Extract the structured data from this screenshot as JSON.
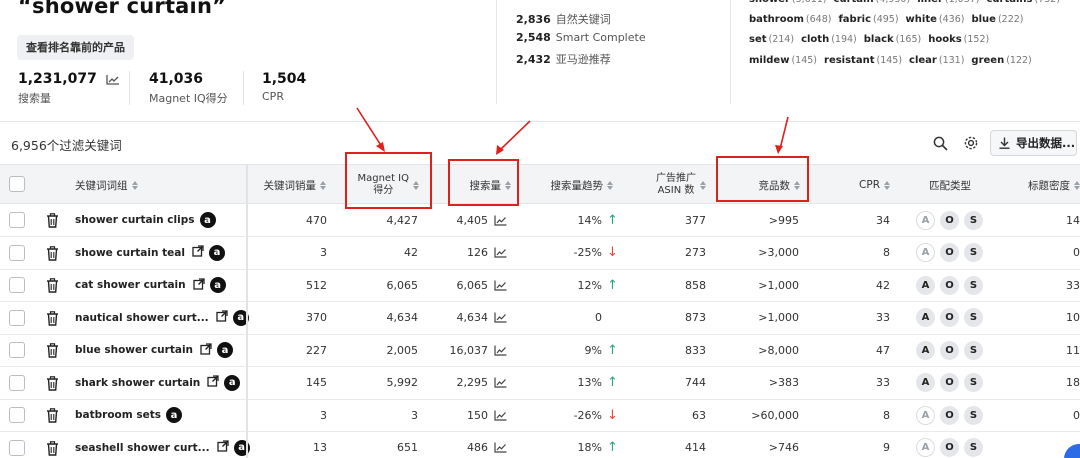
{
  "header": {
    "keyword": "“shower curtain”",
    "see_top_button": "查看排名靠前的产品",
    "stats": [
      {
        "value": "1,231,077",
        "label": "搜索量",
        "has_chart_icon": true
      },
      {
        "value": "41,036",
        "label": "Magnet IQ得分"
      },
      {
        "value": "1,504",
        "label": "CPR"
      }
    ]
  },
  "keyword_sources": [
    {
      "count": "2,836",
      "label": "自然关键词"
    },
    {
      "count": "2,548",
      "label": "Smart Complete"
    },
    {
      "count": "2,432",
      "label": "亚马逊推荐"
    }
  ],
  "word_frequency": [
    [
      {
        "w": "shower",
        "c": "(5,611)"
      },
      {
        "w": "curtain",
        "c": "(4,930)"
      },
      {
        "w": "liner",
        "c": "(1,037)"
      },
      {
        "w": "curtains",
        "c": "(732)"
      }
    ],
    [
      {
        "w": "bathroom",
        "c": "(648)"
      },
      {
        "w": "fabric",
        "c": "(495)"
      },
      {
        "w": "white",
        "c": "(436)"
      },
      {
        "w": "blue",
        "c": "(222)"
      }
    ],
    [
      {
        "w": "set",
        "c": "(214)"
      },
      {
        "w": "cloth",
        "c": "(194)"
      },
      {
        "w": "black",
        "c": "(165)"
      },
      {
        "w": "hooks",
        "c": "(152)"
      }
    ],
    [
      {
        "w": "mildew",
        "c": "(145)"
      },
      {
        "w": "resistant",
        "c": "(145)"
      },
      {
        "w": "clear",
        "c": "(131)"
      },
      {
        "w": "green",
        "c": "(122)"
      }
    ]
  ],
  "toolbar": {
    "filtered_count": "6,956个过滤关键词",
    "export_label": "导出数据..."
  },
  "table": {
    "columns": {
      "keyword_phrase": "关键词词组",
      "keyword_sales": "关键词销量",
      "magnet_iq_line1": "Magnet IQ",
      "magnet_iq_line2": "得分",
      "search_volume": "搜索量",
      "search_trend": "搜索量趋势",
      "ad_asin_line1": "广告推广",
      "ad_asin_line2": "ASIN 数",
      "competing_products": "竞品数",
      "cpr": "CPR",
      "match_type": "匹配类型",
      "title_density": "标题密度"
    },
    "rows": [
      {
        "keyword": "shower curtain clips",
        "sales": "470",
        "iq": "4,427",
        "volume": "4,405",
        "trend": "14%",
        "trend_dir": "up",
        "asins": "377",
        "competing": ">995",
        "cpr": "34",
        "match": [
          "A",
          "O",
          "S"
        ],
        "match_on": [
          false,
          true,
          true
        ],
        "density": "14",
        "ext": false
      },
      {
        "keyword": "showe curtain teal",
        "sales": "3",
        "iq": "42",
        "volume": "126",
        "trend": "-25%",
        "trend_dir": "down",
        "asins": "273",
        "competing": ">3,000",
        "cpr": "8",
        "match": [
          "A",
          "O",
          "S"
        ],
        "match_on": [
          false,
          true,
          true
        ],
        "density": "0",
        "ext": true
      },
      {
        "keyword": "cat shower curtain",
        "sales": "512",
        "iq": "6,065",
        "volume": "6,065",
        "trend": "12%",
        "trend_dir": "up",
        "asins": "858",
        "competing": ">1,000",
        "cpr": "42",
        "match": [
          "A",
          "O",
          "S"
        ],
        "match_on": [
          true,
          true,
          true
        ],
        "density": "33",
        "ext": true
      },
      {
        "keyword": "nautical shower curt...",
        "sales": "370",
        "iq": "4,634",
        "volume": "4,634",
        "trend": "0",
        "trend_dir": "none",
        "asins": "873",
        "competing": ">1,000",
        "cpr": "33",
        "match": [
          "A",
          "O",
          "S"
        ],
        "match_on": [
          true,
          true,
          true
        ],
        "density": "10",
        "ext": true
      },
      {
        "keyword": "blue shower curtain",
        "sales": "227",
        "iq": "2,005",
        "volume": "16,037",
        "trend": "9%",
        "trend_dir": "up",
        "asins": "833",
        "competing": ">8,000",
        "cpr": "47",
        "match": [
          "A",
          "O",
          "S"
        ],
        "match_on": [
          true,
          true,
          true
        ],
        "density": "11",
        "ext": true
      },
      {
        "keyword": "shark shower curtain",
        "sales": "145",
        "iq": "5,992",
        "volume": "2,295",
        "trend": "13%",
        "trend_dir": "up",
        "asins": "744",
        "competing": ">383",
        "cpr": "33",
        "match": [
          "A",
          "O",
          "S"
        ],
        "match_on": [
          true,
          true,
          true
        ],
        "density": "18",
        "ext": true
      },
      {
        "keyword": "batbroom sets",
        "sales": "3",
        "iq": "3",
        "volume": "150",
        "trend": "-26%",
        "trend_dir": "down",
        "asins": "63",
        "competing": ">60,000",
        "cpr": "8",
        "match": [
          "A",
          "O",
          "S"
        ],
        "match_on": [
          false,
          true,
          true
        ],
        "density": "0",
        "ext": false
      },
      {
        "keyword": "seashell shower curt...",
        "sales": "13",
        "iq": "651",
        "volume": "486",
        "trend": "18%",
        "trend_dir": "up",
        "asins": "414",
        "competing": ">746",
        "cpr": "9",
        "match": [
          "A",
          "O",
          "S"
        ],
        "match_on": [
          false,
          true,
          true
        ],
        "density": "",
        "ext": true
      }
    ]
  },
  "colors": {
    "annotation_red": "#e0201b",
    "trend_up": "#28a77b",
    "trend_down": "#e0473c",
    "header_bg": "#f3f4f6"
  }
}
